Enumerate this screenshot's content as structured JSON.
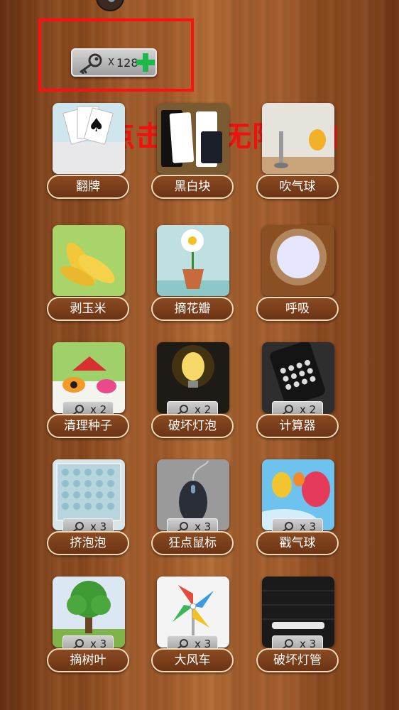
{
  "header": {
    "key_count_prefix": "X",
    "key_count": "128",
    "annotation": "点击加号无限增加"
  },
  "games": [
    {
      "name": "翻牌",
      "locked": false
    },
    {
      "name": "黑白块",
      "locked": false
    },
    {
      "name": "吹气球",
      "locked": false
    },
    {
      "name": "剥玉米",
      "locked": false
    },
    {
      "name": "摘花瓣",
      "locked": false
    },
    {
      "name": "呼吸",
      "locked": false
    },
    {
      "name": "清理种子",
      "locked": true,
      "cost": "x 2"
    },
    {
      "name": "破坏灯泡",
      "locked": true,
      "cost": "x 2"
    },
    {
      "name": "计算器",
      "locked": true,
      "cost": "x 2"
    },
    {
      "name": "挤泡泡",
      "locked": true,
      "cost": "x 3"
    },
    {
      "name": "狂点鼠标",
      "locked": true,
      "cost": "x 3"
    },
    {
      "name": "戳气球",
      "locked": true,
      "cost": "x 3"
    },
    {
      "name": "摘树叶",
      "locked": true,
      "cost": "x 3"
    },
    {
      "name": "大风车",
      "locked": true,
      "cost": "x 3"
    },
    {
      "name": "破坏灯管",
      "locked": true,
      "cost": "x 3"
    }
  ],
  "colors": {
    "annotation": "#f01010",
    "highlight_box": "#ff1010",
    "plus_icon": "#1db84a",
    "label_border": "#f2d9b5"
  }
}
